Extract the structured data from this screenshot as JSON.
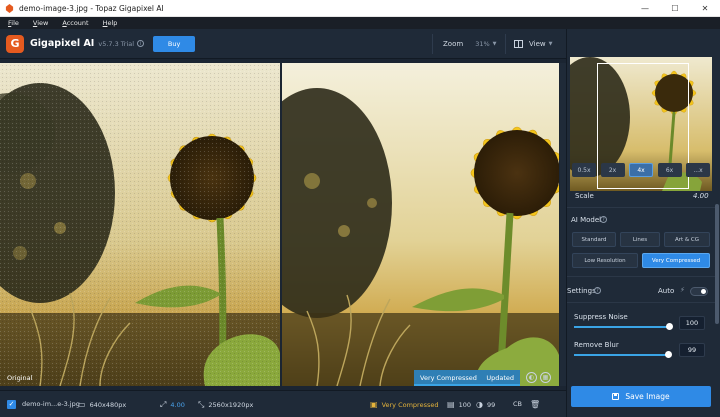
{
  "window": {
    "title": "demo-image-3.jpg - Topaz Gigapixel AI",
    "controls": [
      "—",
      "☐",
      "✕"
    ]
  },
  "menu": [
    "File",
    "View",
    "Account",
    "Help"
  ],
  "header": {
    "brand": "Gigapixel AI",
    "logo_letter": "G",
    "version": "v5.7.3 Trial",
    "buy_label": "Buy",
    "zoom_label": "Zoom",
    "zoom_value": "31%",
    "view_label": "View"
  },
  "preview": {
    "original_label": "Original",
    "model": "Very Compressed",
    "status": "Updated"
  },
  "statusbar": {
    "filename": "demo-im...e-3.jpg",
    "input_size": "640x480px",
    "scale": "4.00",
    "output_size": "2560x1920px",
    "model": "Very Compressed",
    "quality": "100",
    "noise": "99",
    "color_profile": "CB"
  },
  "panel": {
    "scale_options": [
      "0.5x",
      "2x",
      "4x",
      "6x",
      "...x"
    ],
    "scale_active_index": 2,
    "scale_label": "Scale",
    "scale_value": "4.00",
    "ai_model_label": "AI Model",
    "models": [
      "Standard",
      "Lines",
      "Art & CG",
      "Low Resolution",
      "Very Compressed"
    ],
    "active_model": "Very Compressed",
    "settings_label": "Settings",
    "auto_label": "Auto",
    "suppress_noise_label": "Suppress Noise",
    "suppress_noise_value": "100",
    "remove_blur_label": "Remove Blur",
    "remove_blur_value": "99",
    "save_label": "Save Image"
  },
  "colors": {
    "accent": "#2f8ae6",
    "panel_bg": "#1f2a38",
    "app_bg": "#1b2532",
    "brand_orange": "#e55a1f"
  }
}
